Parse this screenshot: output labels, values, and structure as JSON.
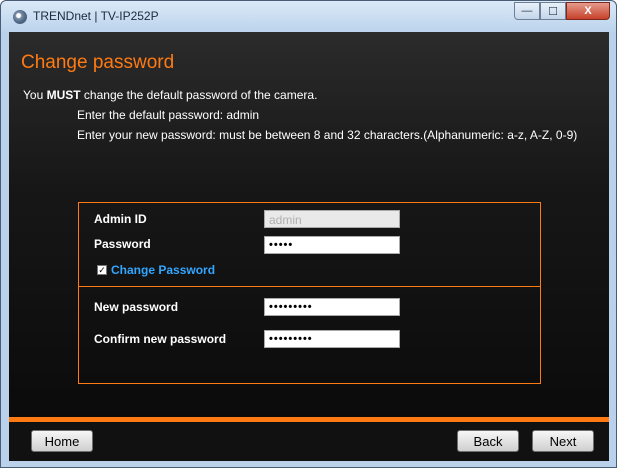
{
  "window": {
    "title": "TRENDnet | TV-IP252P",
    "min_glyph": "—",
    "max_glyph": "☐",
    "close_glyph": "X"
  },
  "page": {
    "title": "Change password",
    "must_prefix": "You ",
    "must_word": "MUST",
    "must_suffix": " change the default password of the camera.",
    "line1": "Enter the default password: admin",
    "line2": "Enter your new password: must be between 8 and 32 characters.(Alphanumeric: a-z, A-Z, 0-9)"
  },
  "form": {
    "admin_id_label": "Admin ID",
    "admin_id_value": "admin",
    "password_label": "Password",
    "password_value": "•••••",
    "change_password_label": "Change Password",
    "change_password_checked": true,
    "new_password_label": "New password",
    "new_password_value": "•••••••••",
    "confirm_password_label": "Confirm new password",
    "confirm_password_value": "•••••••••"
  },
  "footer": {
    "home_label": "Home",
    "back_label": "Back",
    "next_label": "Next"
  },
  "colors": {
    "accent_orange": "#ff7a12",
    "link_blue": "#33a6ff"
  }
}
